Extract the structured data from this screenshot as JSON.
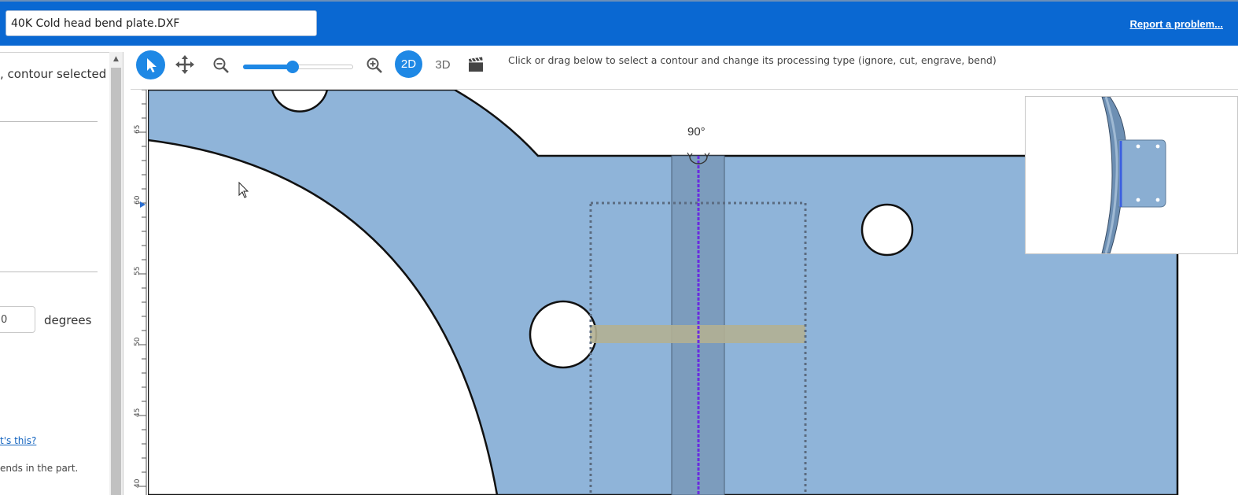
{
  "header": {
    "file_name": "40K Cold head bend plate.DXF",
    "report_link": "Report a problem..."
  },
  "left_panel": {
    "selection_text": ", contour selected",
    "angle_value": "0",
    "angle_unit": "degrees",
    "whats_this_link": "t's this?",
    "bends_text": "ends in the part."
  },
  "toolbar": {
    "zoom_fraction": 0.45,
    "view_2d": "2D",
    "view_3d": "3D",
    "active_view": "2D",
    "hint": "Click or drag below to select a contour and change its processing type (ignore, cut, engrave, bend)"
  },
  "canvas": {
    "bend_angle": "90°",
    "ruler_labels": [
      "65",
      "60",
      "55",
      "50",
      "45",
      "40"
    ],
    "part_fill": "#8fb4d9",
    "bend_line_color": "#6a2be0",
    "icons": [
      "select-arrow-icon",
      "pan-arrows-icon",
      "zoom-out-icon",
      "zoom-in-icon",
      "movie-clapper-icon",
      "mouse-cursor-icon",
      "bend-rotate-icon"
    ]
  }
}
